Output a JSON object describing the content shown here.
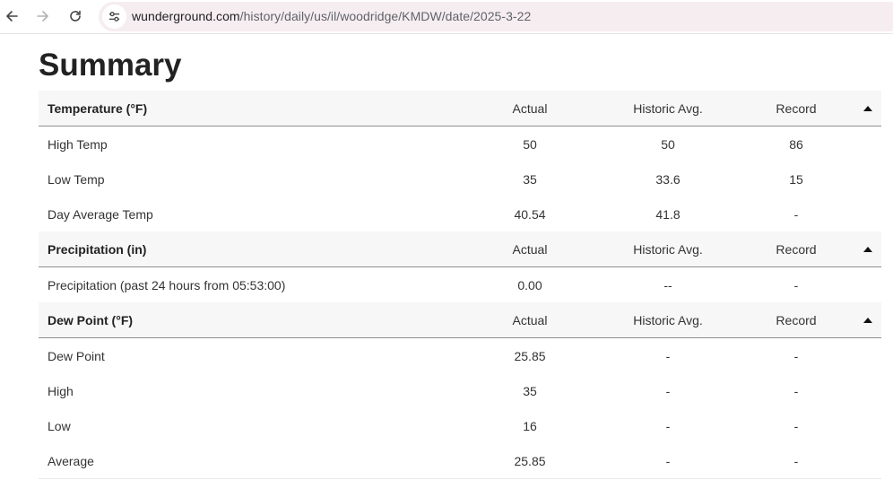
{
  "browser": {
    "url_domain": "wunderground.com",
    "url_path": "/history/daily/us/il/woodridge/KMDW/date/2025-3-22",
    "icons": {
      "back": "arrow-left-icon",
      "forward": "arrow-right-icon",
      "reload": "reload-icon",
      "site_info": "tune-icon"
    }
  },
  "page": {
    "title": "Summary"
  },
  "sections": [
    {
      "header": {
        "name": "Temperature (°F)",
        "actual": "Actual",
        "historic": "Historic Avg.",
        "record": "Record"
      },
      "rows": [
        {
          "name": "High Temp",
          "actual": "50",
          "historic": "50",
          "record": "86"
        },
        {
          "name": "Low Temp",
          "actual": "35",
          "historic": "33.6",
          "record": "15"
        },
        {
          "name": "Day Average Temp",
          "actual": "40.54",
          "historic": "41.8",
          "record": "-"
        }
      ]
    },
    {
      "header": {
        "name": "Precipitation (in)",
        "actual": "Actual",
        "historic": "Historic Avg.",
        "record": "Record"
      },
      "rows": [
        {
          "name": "Precipitation (past 24 hours from 05:53:00)",
          "actual": "0.00",
          "historic": "--",
          "record": "-"
        }
      ]
    },
    {
      "header": {
        "name": "Dew Point (°F)",
        "actual": "Actual",
        "historic": "Historic Avg.",
        "record": "Record"
      },
      "rows": [
        {
          "name": "Dew Point",
          "actual": "25.85",
          "historic": "-",
          "record": "-"
        },
        {
          "name": "High",
          "actual": "35",
          "historic": "-",
          "record": "-"
        },
        {
          "name": "Low",
          "actual": "16",
          "historic": "-",
          "record": "-"
        },
        {
          "name": "Average",
          "actual": "25.85",
          "historic": "-",
          "record": "-"
        }
      ]
    }
  ]
}
